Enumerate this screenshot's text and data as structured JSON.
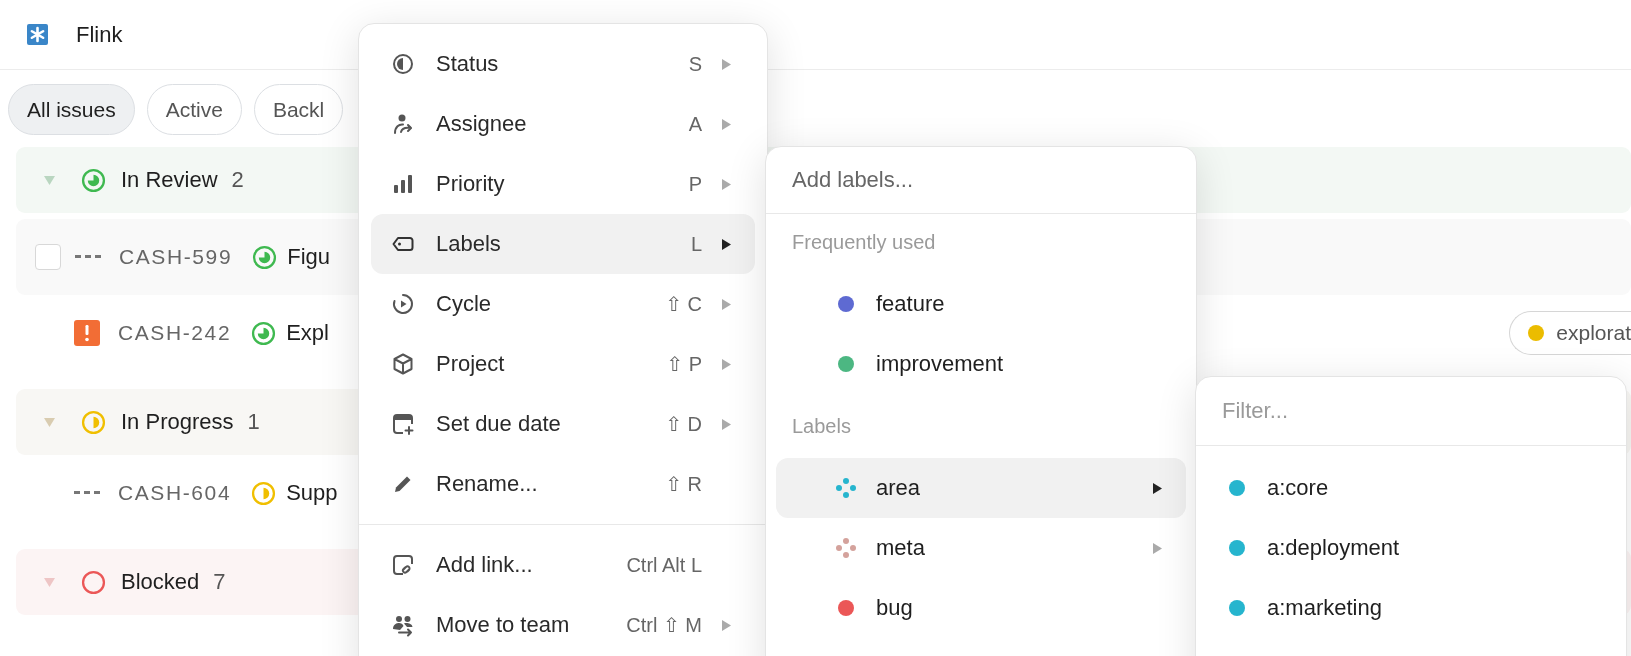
{
  "app": {
    "name": "Flink"
  },
  "views": [
    {
      "label": "All issues",
      "selected": true
    },
    {
      "label": "Active",
      "selected": false
    },
    {
      "label": "Backl",
      "selected": false
    }
  ],
  "groups": [
    {
      "name": "In Review",
      "count": "2",
      "kind": "review",
      "expanded": true,
      "issues": [
        {
          "id": "CASH-599",
          "kind": "no_priority",
          "title": "Figu",
          "hovered": true,
          "checked": false
        },
        {
          "id": "CASH-242",
          "kind": "urgent",
          "title": "Expl",
          "hovered": false,
          "labels": [
            {
              "name": "explorat",
              "color": "#ebbc00"
            }
          ]
        }
      ]
    },
    {
      "name": "In Progress",
      "count": "1",
      "kind": "progress",
      "expanded": true,
      "issues": [
        {
          "id": "CASH-604",
          "kind": "no_priority",
          "title": "Supp",
          "hovered": false
        }
      ]
    },
    {
      "name": "Blocked",
      "count": "7",
      "kind": "blocked",
      "expanded": true
    }
  ],
  "context_menu": {
    "sections": [
      [
        {
          "label": "Status",
          "shortcut": "S",
          "submenu": true,
          "selected": false
        },
        {
          "label": "Assignee",
          "shortcut": "A",
          "submenu": true,
          "selected": false
        },
        {
          "label": "Priority",
          "shortcut": "P",
          "submenu": true,
          "selected": false
        },
        {
          "label": "Labels",
          "shortcut": "L",
          "submenu": true,
          "selected": true
        },
        {
          "label": "Cycle",
          "shortcut": "⇧ C",
          "submenu": true,
          "selected": false
        },
        {
          "label": "Project",
          "shortcut": "⇧ P",
          "submenu": true,
          "selected": false
        },
        {
          "label": "Set due date",
          "shortcut": "⇧ D",
          "submenu": true,
          "selected": false
        },
        {
          "label": "Rename...",
          "shortcut": "⇧ R",
          "submenu": false,
          "selected": false
        }
      ],
      [
        {
          "label": "Add link...",
          "shortcut": "Ctrl Alt L",
          "submenu": false,
          "selected": false
        },
        {
          "label": "Move to team",
          "shortcut": "Ctrl ⇧ M",
          "submenu": true,
          "selected": false
        }
      ]
    ]
  },
  "labels_menu": {
    "placeholder": "Add labels...",
    "sections": [
      {
        "heading": "Frequently used",
        "items": [
          {
            "name": "feature",
            "kind": "label",
            "color": "#5e6ad2",
            "selected": false
          },
          {
            "name": "improvement",
            "kind": "label",
            "color": "#4cb782",
            "selected": false
          }
        ]
      },
      {
        "heading": "Labels",
        "items": [
          {
            "name": "area",
            "kind": "group",
            "color": "#26b5ce",
            "selected": true
          },
          {
            "name": "meta",
            "kind": "group",
            "color": "#d4a29c",
            "selected": false
          },
          {
            "name": "bug",
            "kind": "label",
            "color": "#eb5757",
            "selected": false
          }
        ]
      }
    ]
  },
  "area_menu": {
    "placeholder": "Filter...",
    "items": [
      {
        "name": "a:core",
        "color": "#26b5ce"
      },
      {
        "name": "a:deployment",
        "color": "#26b5ce"
      },
      {
        "name": "a:marketing",
        "color": "#26b5ce"
      }
    ]
  }
}
